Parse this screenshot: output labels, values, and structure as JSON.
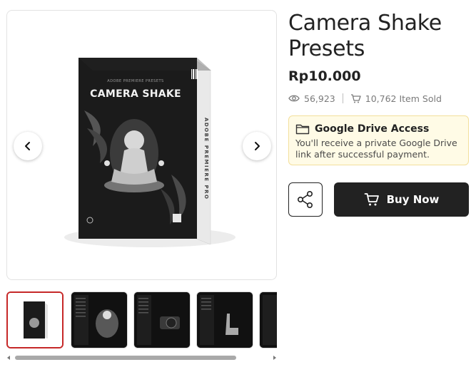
{
  "product": {
    "title": "Camera Shake Presets",
    "price": "Rp10.000",
    "views": "56,923",
    "sold": "10,762 Item Sold"
  },
  "box_art": {
    "top_caption": "ADOBE PREMIERE PRESETS",
    "headline": "CAMERA SHAKE",
    "spine_text": "ADOBE PREMIERE PRO"
  },
  "drive_notice": {
    "title": "Google Drive Access",
    "text": "You'll receive a private Google Drive link after successful payment."
  },
  "actions": {
    "buy_label": "Buy Now"
  },
  "gallery": {
    "thumbnail_count": 5,
    "active_index": 0
  },
  "colors": {
    "primary_button": "#222222",
    "active_thumb_border": "#c62828",
    "notice_bg": "#fffbe6",
    "notice_border": "#f3df9c"
  }
}
